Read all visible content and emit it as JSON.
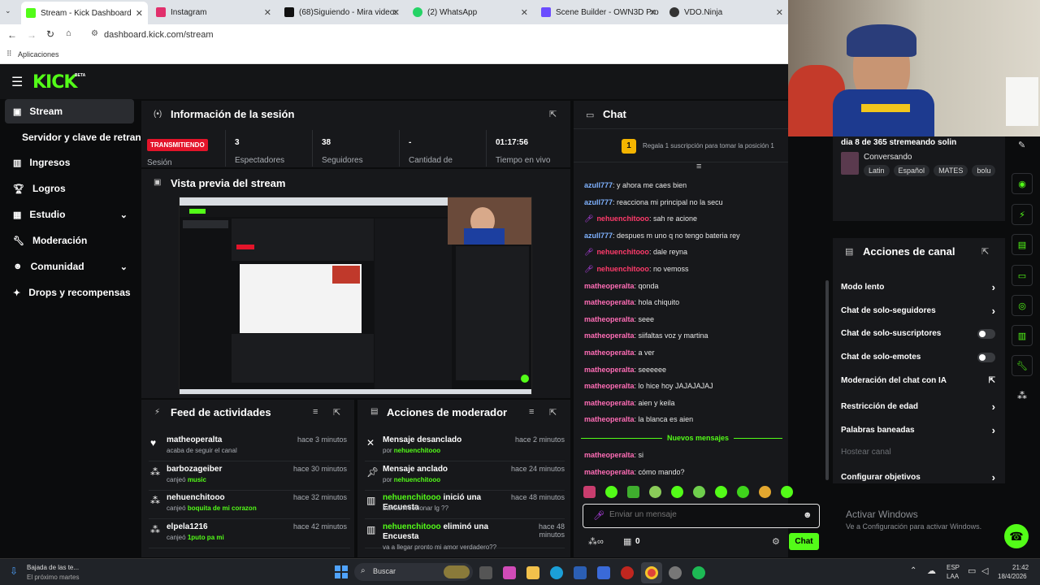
{
  "browser": {
    "tabs": [
      {
        "label": "Stream - Kick Dashboard",
        "active": true
      },
      {
        "label": "Instagram"
      },
      {
        "label": "(68)Siguiendo - Mira videos pu"
      },
      {
        "label": "(2) WhatsApp"
      },
      {
        "label": "Scene Builder - OWN3D Pro"
      },
      {
        "label": "VDO.Ninja"
      }
    ],
    "url": "dashboard.kick.com/stream",
    "bookmark": "Aplicaciones"
  },
  "brand": {
    "logo": "KICK",
    "beta": "BETA",
    "accent": "#53fc18"
  },
  "sidebar": {
    "items": [
      {
        "label": "Stream",
        "icon": "broadcast-icon",
        "active": true
      },
      {
        "label": "Servidor y clave de retransm"
      },
      {
        "label": "Ingresos",
        "icon": "bars-icon"
      },
      {
        "label": "Logros",
        "icon": "trophy-icon"
      },
      {
        "label": "Estudio",
        "icon": "grid-icon"
      },
      {
        "label": "Moderación",
        "icon": "wrench-icon"
      },
      {
        "label": "Comunidad",
        "icon": "people-icon"
      },
      {
        "label": "Drops y recompensas",
        "icon": "drops-icon"
      }
    ]
  },
  "session": {
    "title": "Información de la sesión",
    "status": "TRANSMITIENDO",
    "status_label": "Sesión",
    "stats": [
      {
        "value": "3",
        "label": "Espectadores"
      },
      {
        "value": "38",
        "label": "Seguidores"
      },
      {
        "value": "-",
        "label": "Cantidad de"
      },
      {
        "value": "01:17:56",
        "label": "Tiempo en vivo"
      }
    ]
  },
  "preview": {
    "title": "Vista previa del stream"
  },
  "feed": {
    "title": "Feed de actividades",
    "items": [
      {
        "user": "matheoperalta",
        "action": "acaba de seguir el canal",
        "extra": "",
        "time": "hace 3 minutos"
      },
      {
        "user": "barbozageiber",
        "action": "canjeó",
        "extra": "music",
        "time": "hace 30 minutos"
      },
      {
        "user": "nehuenchitooo",
        "action": "canjeó",
        "extra": "boquita de mi corazon",
        "time": "hace 32 minutos"
      },
      {
        "user": "elpela1216",
        "action": "canjeó",
        "extra": "1puto pa mi",
        "time": "hace 42 minutos"
      }
    ]
  },
  "mod": {
    "title": "Acciones de moderador",
    "items": [
      {
        "title": "Mensaje desanclado",
        "sub": "por",
        "user": "nehuenchitooo",
        "time": "hace 2 minutos"
      },
      {
        "title": "Mensaje anclado",
        "sub": "por",
        "user": "nehuenchitooo",
        "time": "hace 24 minutos"
      },
      {
        "title_user": "nehuenchitooo",
        "title": "inició una Encuesta",
        "sub": "bancan reccionar lg ??",
        "time": "hace 48 minutos"
      },
      {
        "title_user": "nehuenchitooo",
        "title": "eliminó una Encuesta",
        "sub": "va a llegar pronto mi amor verdadero??",
        "time": "hace 48 minutos"
      }
    ]
  },
  "chat": {
    "title": "Chat",
    "gift_rank": "1",
    "gift_text": "Regala 1 suscripción para tomar la posición 1",
    "messages": [
      {
        "user": "azull777",
        "color": "blue",
        "text": ": y ahora me caes bien"
      },
      {
        "user": "azull777",
        "color": "blue",
        "text": ": reacciona mi principal no la secu"
      },
      {
        "user": "nehuenchitooo",
        "color": "mag",
        "text": ": sah re acione"
      },
      {
        "user": "azull777",
        "color": "blue",
        "text": ": despues m uno q no tengo bateria rey"
      },
      {
        "user": "nehuenchitooo",
        "color": "mag",
        "text": ": dale reyna"
      },
      {
        "user": "nehuenchitooo",
        "color": "mag",
        "text": ": no vemoss"
      },
      {
        "user": "matheoperalta",
        "color": "pink",
        "text": ": qonda"
      },
      {
        "user": "matheoperalta",
        "color": "pink",
        "text": ": hola chiquito"
      },
      {
        "user": "matheoperalta",
        "color": "pink",
        "text": ": seee"
      },
      {
        "user": "matheoperalta",
        "color": "pink",
        "text": ": siifaltas voz y martina"
      },
      {
        "user": "matheoperalta",
        "color": "pink",
        "text": ": a ver"
      },
      {
        "user": "matheoperalta",
        "color": "pink",
        "text": ": seeeeee"
      },
      {
        "user": "matheoperalta",
        "color": "pink",
        "text": ": lo hice hoy JAJAJAJAJ"
      },
      {
        "user": "matheoperalta",
        "color": "pink",
        "text": ": aien y keila"
      },
      {
        "user": "matheoperalta",
        "color": "pink",
        "text": ": la blanca es aien"
      }
    ],
    "new_divider": "Nuevos mensajes",
    "new_messages": [
      {
        "user": "matheoperalta",
        "color": "pink",
        "text": ": si"
      },
      {
        "user": "matheoperalta",
        "color": "pink",
        "text": ": cómo mando?"
      }
    ],
    "placeholder": "Enviar un mensaje",
    "points": "0",
    "send": "Chat"
  },
  "stream_info": {
    "title": "dia 8 de 365 stremeando solin",
    "category": "Conversando",
    "tags": [
      "Latin",
      "Español",
      "MATES",
      "bolu"
    ]
  },
  "channel": {
    "title": "Acciones de canal",
    "rows": [
      {
        "label": "Modo lento",
        "control": "chevron"
      },
      {
        "label": "Chat de solo-seguidores",
        "control": "chevron"
      },
      {
        "label": "Chat de solo-suscriptores",
        "control": "toggle"
      },
      {
        "label": "Chat de solo-emotes",
        "control": "toggle"
      },
      {
        "label": "Moderación del chat con IA",
        "control": "external"
      },
      {
        "label": "Restricción de edad",
        "control": "chevron"
      },
      {
        "label": "Palabras baneadas",
        "control": "chevron"
      },
      {
        "label": "Hostear canal",
        "control": "none",
        "disabled": true
      },
      {
        "label": "Configurar objetivos",
        "control": "chevron"
      }
    ]
  },
  "watermark": {
    "title": "Activar Windows",
    "sub": "Ve a Configuración para activar Windows."
  },
  "taskbar": {
    "download_title": "Bajada de las te...",
    "download_sub": "El próximo martes",
    "search": "Buscar",
    "lang1": "ESP",
    "lang2": "LAA",
    "time": "21:42",
    "date": "18/4/2026"
  }
}
